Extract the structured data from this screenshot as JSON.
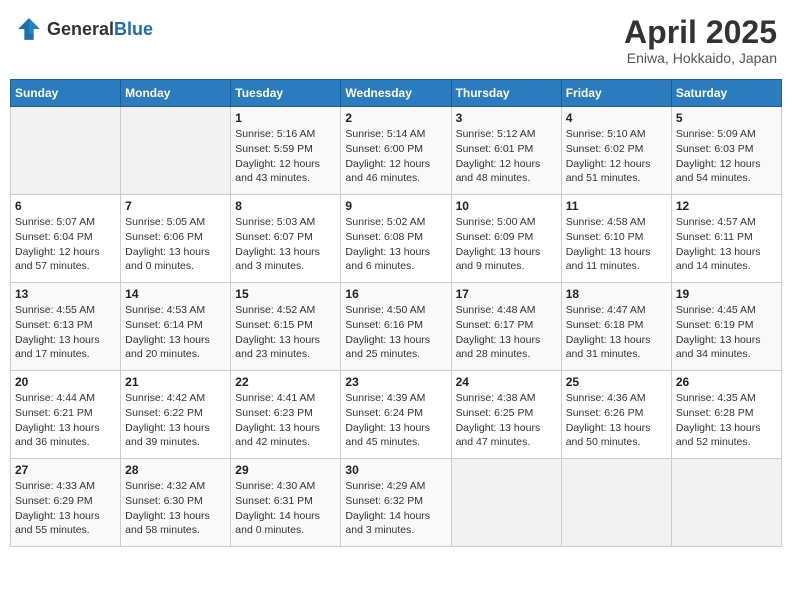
{
  "header": {
    "logo_general": "General",
    "logo_blue": "Blue",
    "title": "April 2025",
    "subtitle": "Eniwa, Hokkaido, Japan"
  },
  "weekdays": [
    "Sunday",
    "Monday",
    "Tuesday",
    "Wednesday",
    "Thursday",
    "Friday",
    "Saturday"
  ],
  "weeks": [
    [
      {
        "num": "",
        "info": ""
      },
      {
        "num": "",
        "info": ""
      },
      {
        "num": "1",
        "info": "Sunrise: 5:16 AM\nSunset: 5:59 PM\nDaylight: 12 hours and 43 minutes."
      },
      {
        "num": "2",
        "info": "Sunrise: 5:14 AM\nSunset: 6:00 PM\nDaylight: 12 hours and 46 minutes."
      },
      {
        "num": "3",
        "info": "Sunrise: 5:12 AM\nSunset: 6:01 PM\nDaylight: 12 hours and 48 minutes."
      },
      {
        "num": "4",
        "info": "Sunrise: 5:10 AM\nSunset: 6:02 PM\nDaylight: 12 hours and 51 minutes."
      },
      {
        "num": "5",
        "info": "Sunrise: 5:09 AM\nSunset: 6:03 PM\nDaylight: 12 hours and 54 minutes."
      }
    ],
    [
      {
        "num": "6",
        "info": "Sunrise: 5:07 AM\nSunset: 6:04 PM\nDaylight: 12 hours and 57 minutes."
      },
      {
        "num": "7",
        "info": "Sunrise: 5:05 AM\nSunset: 6:06 PM\nDaylight: 13 hours and 0 minutes."
      },
      {
        "num": "8",
        "info": "Sunrise: 5:03 AM\nSunset: 6:07 PM\nDaylight: 13 hours and 3 minutes."
      },
      {
        "num": "9",
        "info": "Sunrise: 5:02 AM\nSunset: 6:08 PM\nDaylight: 13 hours and 6 minutes."
      },
      {
        "num": "10",
        "info": "Sunrise: 5:00 AM\nSunset: 6:09 PM\nDaylight: 13 hours and 9 minutes."
      },
      {
        "num": "11",
        "info": "Sunrise: 4:58 AM\nSunset: 6:10 PM\nDaylight: 13 hours and 11 minutes."
      },
      {
        "num": "12",
        "info": "Sunrise: 4:57 AM\nSunset: 6:11 PM\nDaylight: 13 hours and 14 minutes."
      }
    ],
    [
      {
        "num": "13",
        "info": "Sunrise: 4:55 AM\nSunset: 6:13 PM\nDaylight: 13 hours and 17 minutes."
      },
      {
        "num": "14",
        "info": "Sunrise: 4:53 AM\nSunset: 6:14 PM\nDaylight: 13 hours and 20 minutes."
      },
      {
        "num": "15",
        "info": "Sunrise: 4:52 AM\nSunset: 6:15 PM\nDaylight: 13 hours and 23 minutes."
      },
      {
        "num": "16",
        "info": "Sunrise: 4:50 AM\nSunset: 6:16 PM\nDaylight: 13 hours and 25 minutes."
      },
      {
        "num": "17",
        "info": "Sunrise: 4:48 AM\nSunset: 6:17 PM\nDaylight: 13 hours and 28 minutes."
      },
      {
        "num": "18",
        "info": "Sunrise: 4:47 AM\nSunset: 6:18 PM\nDaylight: 13 hours and 31 minutes."
      },
      {
        "num": "19",
        "info": "Sunrise: 4:45 AM\nSunset: 6:19 PM\nDaylight: 13 hours and 34 minutes."
      }
    ],
    [
      {
        "num": "20",
        "info": "Sunrise: 4:44 AM\nSunset: 6:21 PM\nDaylight: 13 hours and 36 minutes."
      },
      {
        "num": "21",
        "info": "Sunrise: 4:42 AM\nSunset: 6:22 PM\nDaylight: 13 hours and 39 minutes."
      },
      {
        "num": "22",
        "info": "Sunrise: 4:41 AM\nSunset: 6:23 PM\nDaylight: 13 hours and 42 minutes."
      },
      {
        "num": "23",
        "info": "Sunrise: 4:39 AM\nSunset: 6:24 PM\nDaylight: 13 hours and 45 minutes."
      },
      {
        "num": "24",
        "info": "Sunrise: 4:38 AM\nSunset: 6:25 PM\nDaylight: 13 hours and 47 minutes."
      },
      {
        "num": "25",
        "info": "Sunrise: 4:36 AM\nSunset: 6:26 PM\nDaylight: 13 hours and 50 minutes."
      },
      {
        "num": "26",
        "info": "Sunrise: 4:35 AM\nSunset: 6:28 PM\nDaylight: 13 hours and 52 minutes."
      }
    ],
    [
      {
        "num": "27",
        "info": "Sunrise: 4:33 AM\nSunset: 6:29 PM\nDaylight: 13 hours and 55 minutes."
      },
      {
        "num": "28",
        "info": "Sunrise: 4:32 AM\nSunset: 6:30 PM\nDaylight: 13 hours and 58 minutes."
      },
      {
        "num": "29",
        "info": "Sunrise: 4:30 AM\nSunset: 6:31 PM\nDaylight: 14 hours and 0 minutes."
      },
      {
        "num": "30",
        "info": "Sunrise: 4:29 AM\nSunset: 6:32 PM\nDaylight: 14 hours and 3 minutes."
      },
      {
        "num": "",
        "info": ""
      },
      {
        "num": "",
        "info": ""
      },
      {
        "num": "",
        "info": ""
      }
    ]
  ]
}
